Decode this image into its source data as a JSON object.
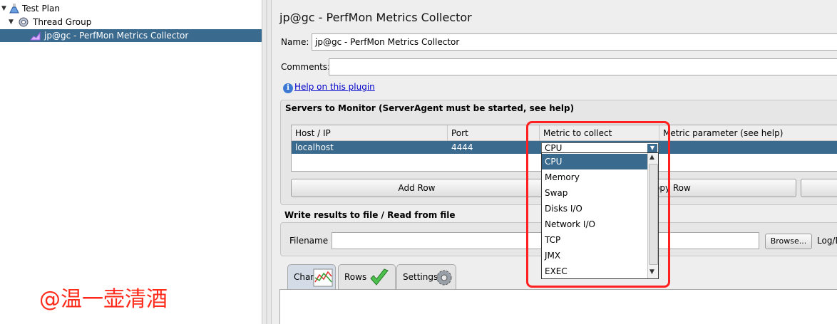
{
  "tree": {
    "test_plan": "Test Plan",
    "thread_group": "Thread Group",
    "perfmon": "jp@gc - PerfMon Metrics Collector"
  },
  "watermark": "@温一壶清酒",
  "panel": {
    "title": "jp@gc - PerfMon Metrics Collector",
    "name_label": "Name:",
    "name_value": "jp@gc - PerfMon Metrics Collector",
    "comments_label": "Comments:",
    "comments_value": "",
    "help_link": "Help on this plugin"
  },
  "servers": {
    "title": "Servers to Monitor (ServerAgent must be started, see help)",
    "columns": [
      "Host / IP",
      "Port",
      "Metric to collect",
      "Metric parameter (see help)"
    ],
    "rows": [
      {
        "host": "localhost",
        "port": "4444",
        "metric": "CPU",
        "param": ""
      }
    ],
    "add_row": "Add Row",
    "copy_row_partial": "opy Row"
  },
  "metric_dropdown": {
    "selected": "CPU",
    "options": [
      "CPU",
      "Memory",
      "Swap",
      "Disks I/O",
      "Network I/O",
      "TCP",
      "JMX",
      "EXEC"
    ]
  },
  "file": {
    "title": "Write results to file / Read from file",
    "filename_label": "Filename",
    "filename_value": "",
    "browse": "Browse...",
    "log_partial": "Log/D"
  },
  "tabs": [
    {
      "label": "Chart"
    },
    {
      "label": "Rows"
    },
    {
      "label": "Settings"
    }
  ],
  "colors": {
    "selection": "#3b6a8f",
    "highlight_box": "#ff2020",
    "link": "#0000cc",
    "watermark": "#ff2a1a"
  }
}
